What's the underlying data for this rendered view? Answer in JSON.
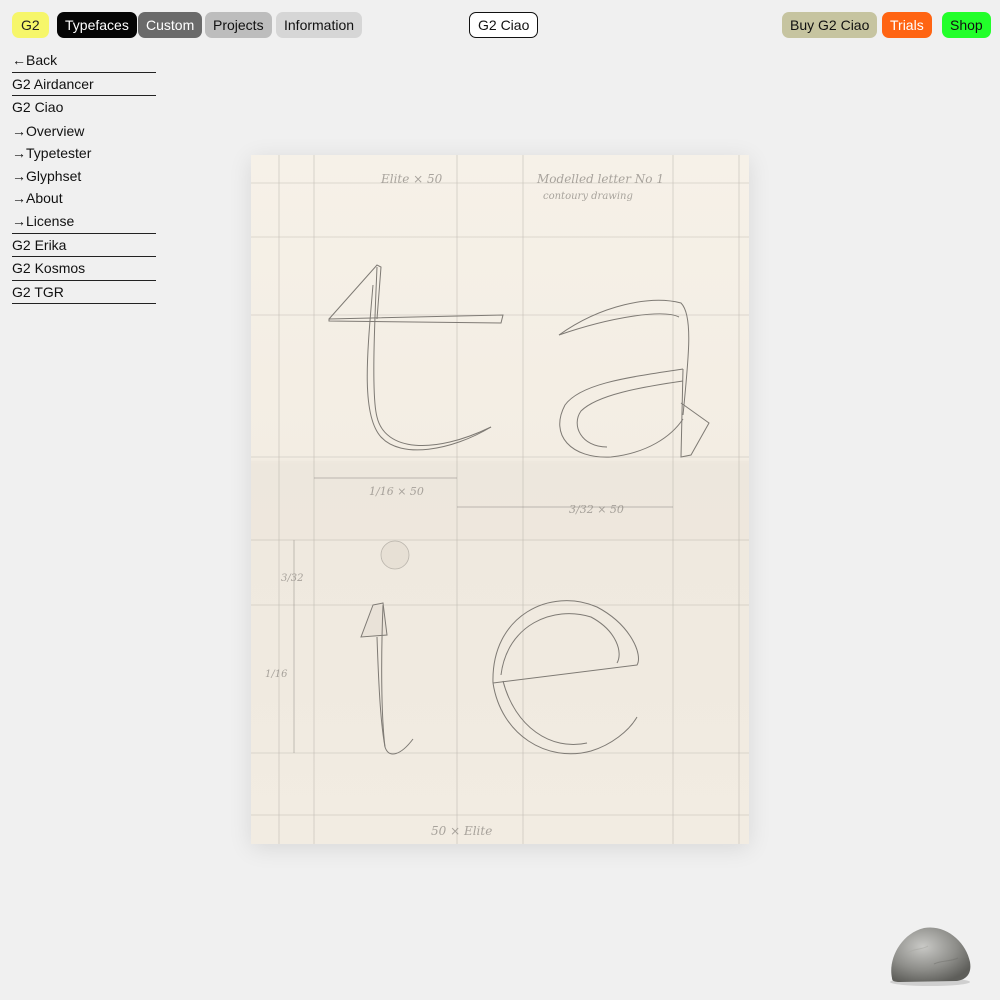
{
  "header": {
    "logo": "G2",
    "nav": {
      "typefaces": "Typefaces",
      "custom": "Custom",
      "projects": "Projects",
      "information": "Information"
    },
    "current_font": "G2 Ciao",
    "actions": {
      "buy": "Buy G2 Ciao",
      "trials": "Trials",
      "shop": "Shop"
    }
  },
  "sidebar": {
    "back": "Back",
    "fonts_above": [
      "G2 Airdancer"
    ],
    "active_font": "G2 Ciao",
    "subnav": [
      "Overview",
      "Typetester",
      "Glyphset",
      "About",
      "License"
    ],
    "fonts_below": [
      "G2 Erika",
      "G2 Kosmos",
      "G2 TGR"
    ]
  },
  "artwork": {
    "pencil_notes": {
      "top_left": "Elite × 50",
      "top_right": "Modelled letter No 1",
      "top_right_sub": "contoury drawing",
      "dim_left": "1/16 × 50",
      "dim_right": "3/32 × 50",
      "side_upper": "3/32",
      "side_lower": "1/16",
      "bottom": "50 × Elite"
    }
  },
  "colors": {
    "background": "#f0f0f0",
    "logo": "#f6f66a",
    "typefaces": "#050505",
    "custom": "#6a6a6a",
    "projects": "#bdbdbd",
    "information": "#d6d6d6",
    "buy": "#c6c4a0",
    "trials": "#ff6412",
    "shop": "#22ff2a",
    "paper": "#f4efe6"
  },
  "icons": [
    "arrow-left-icon",
    "arrow-right-icon",
    "rock-icon"
  ]
}
